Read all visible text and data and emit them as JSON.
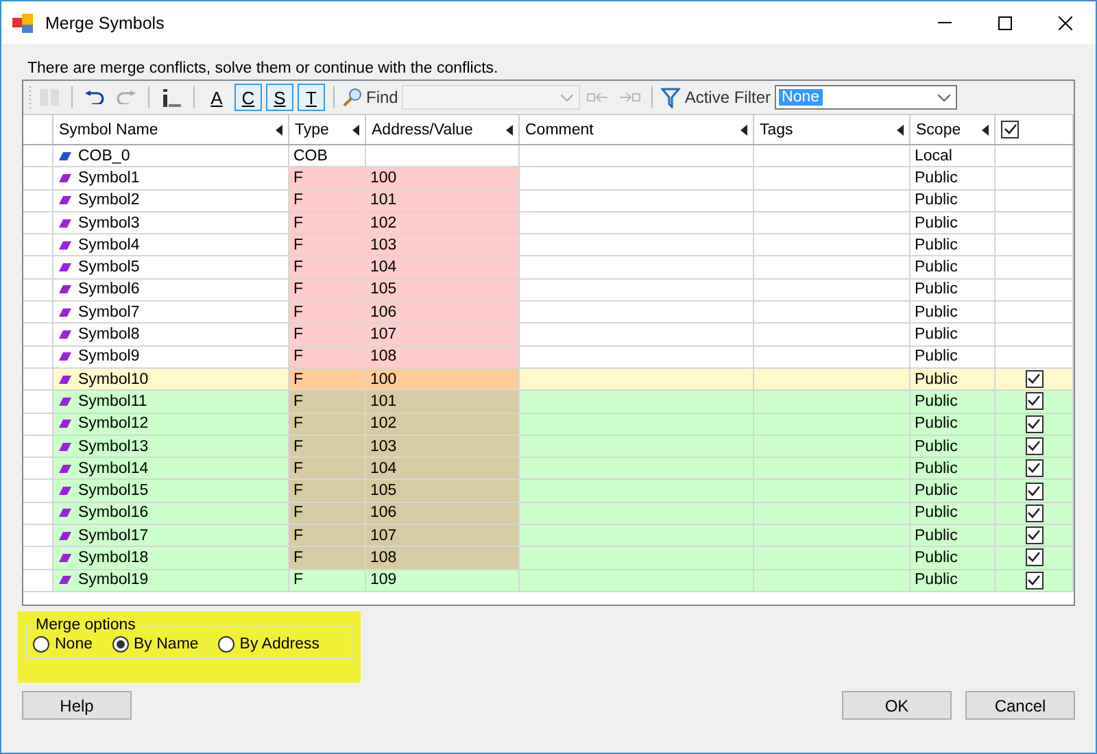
{
  "window": {
    "title": "Merge Symbols"
  },
  "message": "There are merge conflicts, solve them or continue with the conflicts.",
  "toolbar": {
    "toggles": [
      {
        "label": "A",
        "selected": false
      },
      {
        "label": "C",
        "selected": true
      },
      {
        "label": "S",
        "selected": true
      },
      {
        "label": "T",
        "selected": true
      }
    ],
    "find_label": "Find",
    "filter_label": "Active Filter",
    "filter_value": "None"
  },
  "table": {
    "columns": [
      "Symbol Name",
      "Type",
      "Address/Value",
      "Comment",
      "Tags",
      "Scope"
    ],
    "header_checked": true,
    "rows": [
      {
        "name": "COB_0",
        "type": "COB",
        "scope": "Local",
        "kind": "local",
        "checked": false
      },
      {
        "name": "Symbol1",
        "type": "F",
        "address": "100",
        "scope": "Public",
        "kind": "conflict",
        "checked": false
      },
      {
        "name": "Symbol2",
        "type": "F",
        "address": "101",
        "scope": "Public",
        "kind": "conflict",
        "checked": false
      },
      {
        "name": "Symbol3",
        "type": "F",
        "address": "102",
        "scope": "Public",
        "kind": "conflict",
        "checked": false
      },
      {
        "name": "Symbol4",
        "type": "F",
        "address": "103",
        "scope": "Public",
        "kind": "conflict",
        "checked": false
      },
      {
        "name": "Symbol5",
        "type": "F",
        "address": "104",
        "scope": "Public",
        "kind": "conflict",
        "checked": false
      },
      {
        "name": "Symbol6",
        "type": "F",
        "address": "105",
        "scope": "Public",
        "kind": "conflict",
        "checked": false
      },
      {
        "name": "Symbol7",
        "type": "F",
        "address": "106",
        "scope": "Public",
        "kind": "conflict",
        "checked": false
      },
      {
        "name": "Symbol8",
        "type": "F",
        "address": "107",
        "scope": "Public",
        "kind": "conflict",
        "checked": false
      },
      {
        "name": "Symbol9",
        "type": "F",
        "address": "108",
        "scope": "Public",
        "kind": "conflict",
        "checked": false
      },
      {
        "name": "Symbol10",
        "type": "F",
        "address": "100",
        "scope": "Public",
        "kind": "warning",
        "checked": true
      },
      {
        "name": "Symbol11",
        "type": "F",
        "address": "101",
        "scope": "Public",
        "kind": "merged",
        "checked": true
      },
      {
        "name": "Symbol12",
        "type": "F",
        "address": "102",
        "scope": "Public",
        "kind": "merged",
        "checked": true
      },
      {
        "name": "Symbol13",
        "type": "F",
        "address": "103",
        "scope": "Public",
        "kind": "merged",
        "checked": true
      },
      {
        "name": "Symbol14",
        "type": "F",
        "address": "104",
        "scope": "Public",
        "kind": "merged",
        "checked": true
      },
      {
        "name": "Symbol15",
        "type": "F",
        "address": "105",
        "scope": "Public",
        "kind": "merged",
        "checked": true
      },
      {
        "name": "Symbol16",
        "type": "F",
        "address": "106",
        "scope": "Public",
        "kind": "merged",
        "checked": true
      },
      {
        "name": "Symbol17",
        "type": "F",
        "address": "107",
        "scope": "Public",
        "kind": "merged",
        "checked": true
      },
      {
        "name": "Symbol18",
        "type": "F",
        "address": "108",
        "scope": "Public",
        "kind": "merged",
        "checked": true
      },
      {
        "name": "Symbol19",
        "type": "F",
        "address": "109",
        "scope": "Public",
        "kind": "new",
        "checked": true
      }
    ]
  },
  "merge_options": {
    "title": "Merge options",
    "options": [
      {
        "label": "None",
        "selected": false
      },
      {
        "label": "By Name",
        "selected": true
      },
      {
        "label": "By Address",
        "selected": false
      }
    ]
  },
  "buttons": [
    "Help",
    "OK",
    "Cancel"
  ]
}
